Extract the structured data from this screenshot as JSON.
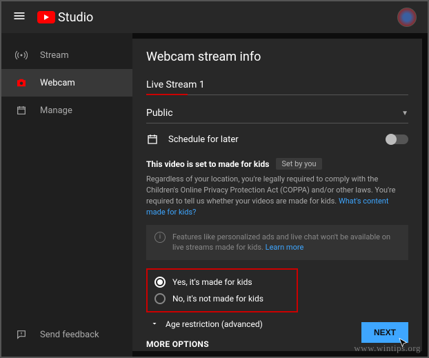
{
  "header": {
    "studio_label": "Studio"
  },
  "sidebar": {
    "items": [
      {
        "label": "Stream"
      },
      {
        "label": "Webcam"
      },
      {
        "label": "Manage"
      }
    ],
    "feedback_label": "Send feedback"
  },
  "panel": {
    "title": "Webcam stream info",
    "stream_title": "Live Stream 1",
    "visibility": "Public",
    "schedule_label": "Schedule for later",
    "kids_heading": "This video is set to made for kids",
    "set_by": "Set by you",
    "kids_desc": "Regardless of your location, you're legally required to comply with the Children's Online Privacy Protection Act (COPPA) and/or other laws. You're required to tell us whether your videos are made for kids. ",
    "kids_link": "What's content made for kids?",
    "info_text": "Features like personalized ads and live chat won't be available on live streams made for kids. ",
    "info_link": "Learn more",
    "radio_yes": "Yes, it's made for kids",
    "radio_no": "No, it's not made for kids",
    "age_label": "Age restriction (advanced)",
    "more_options": "MORE OPTIONS",
    "next": "NEXT"
  },
  "watermark": "www.wintips.org"
}
